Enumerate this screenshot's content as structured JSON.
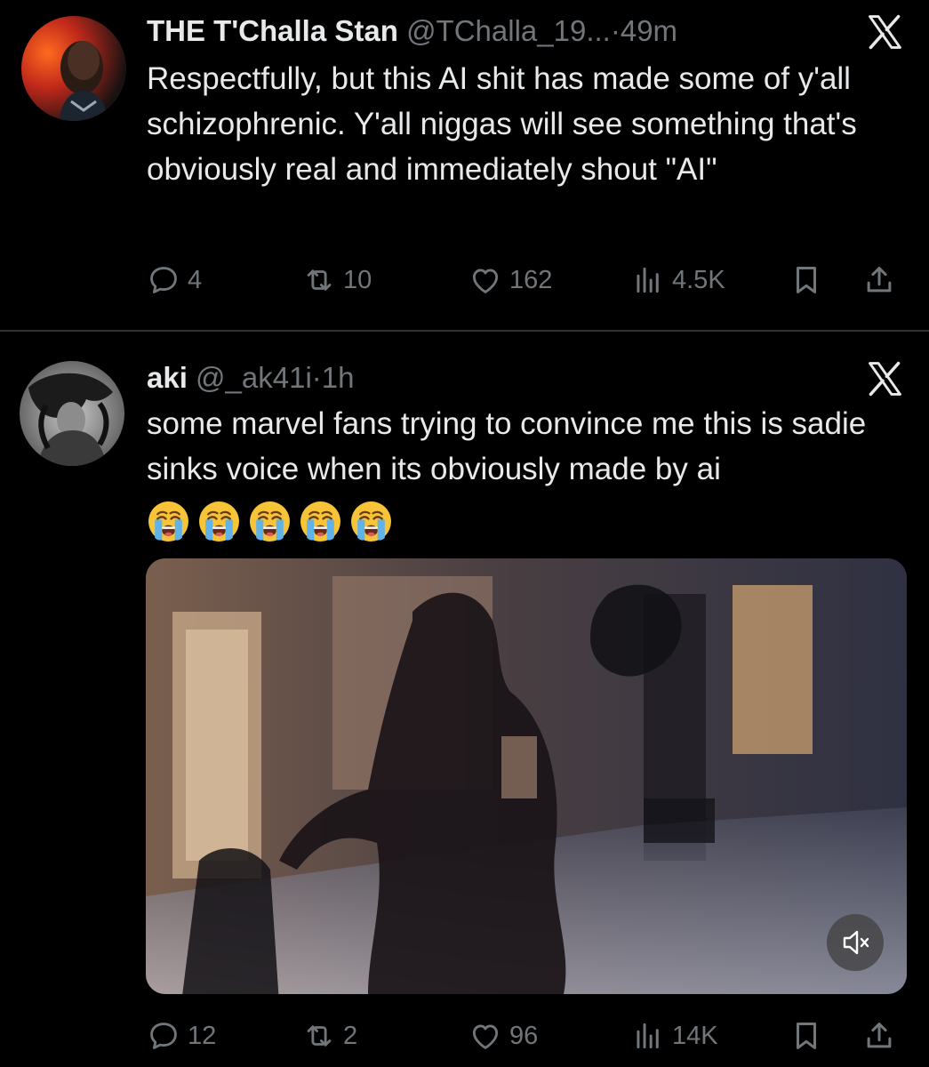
{
  "tweets": [
    {
      "name": "THE T'Challa Stan",
      "handle": "@TChalla_19...",
      "separator": "·",
      "time": "49m",
      "text": "Respectfully, but this AI shit has made some of y'all schizophrenic. Y'all niggas will see something that's obviously real and immediately shout \"AI\"",
      "stats": {
        "replies": "4",
        "reposts": "10",
        "likes": "162",
        "views": "4.5K"
      }
    },
    {
      "name": "aki",
      "handle": "@_ak41i",
      "separator": "·",
      "time": "1h",
      "text": "some marvel fans trying to convince me this is sadie sinks voice when its obviously made by ai",
      "emojis": [
        "loudly-crying-face",
        "loudly-crying-face",
        "loudly-crying-face",
        "loudly-crying-face",
        "loudly-crying-face"
      ],
      "media": {
        "type": "video",
        "muted": true
      },
      "stats": {
        "replies": "12",
        "reposts": "2",
        "likes": "96",
        "views": "14K"
      }
    }
  ],
  "icons": {
    "reply": "speech-bubble-icon",
    "repost": "repost-arrows-icon",
    "like": "heart-icon",
    "views": "bar-chart-icon",
    "bookmark": "bookmark-icon",
    "share": "share-icon",
    "close": "x-close-icon",
    "mute": "muted-speaker-icon"
  },
  "colors": {
    "background": "#000000",
    "primary_text": "#e7e9ea",
    "secondary_text": "#71767b",
    "divider": "#2f3336",
    "emoji_face": "#f7c437",
    "emoji_tears": "#5fb3e8"
  }
}
